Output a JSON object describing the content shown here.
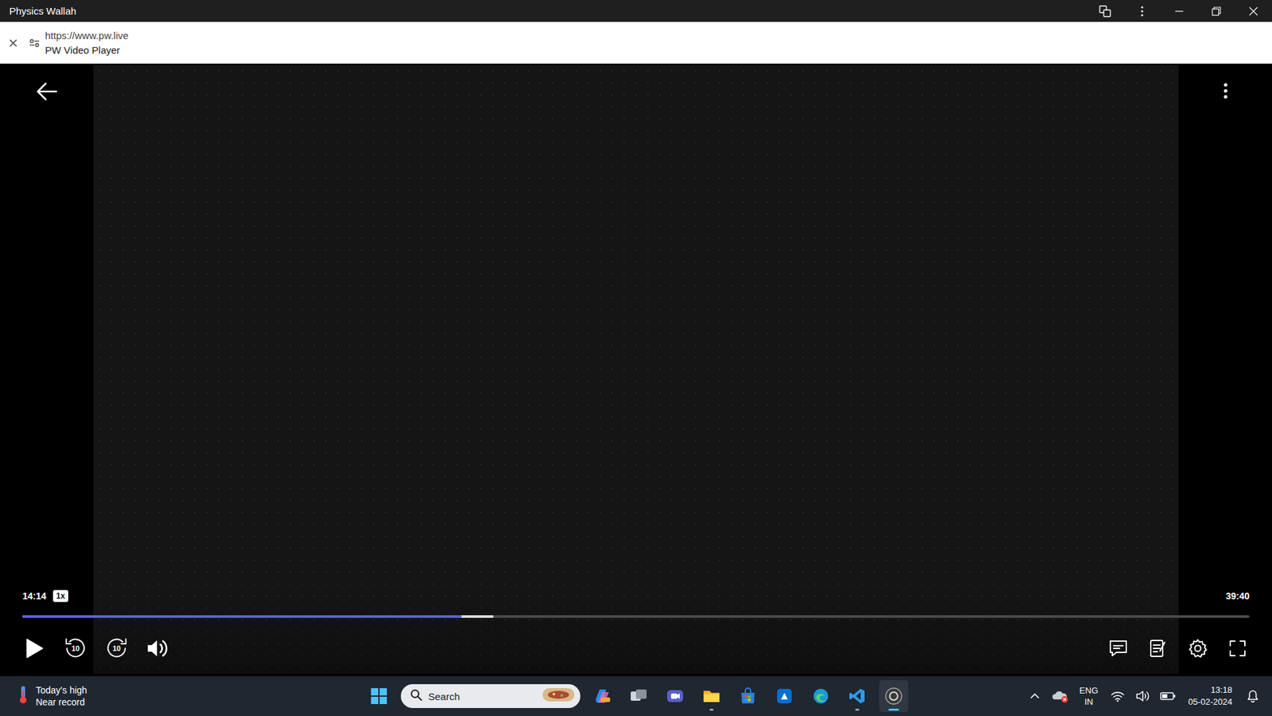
{
  "window": {
    "title": "Physics Wallah"
  },
  "address": {
    "url": "https://www.pw.live",
    "page_title": "PW Video Player"
  },
  "player": {
    "current_time": "14:14",
    "speed": "1x",
    "duration": "39:40",
    "playing": false,
    "progress": {
      "level": 0.358,
      "buffered": 0.384
    },
    "rewind": "10",
    "forward": "10"
  },
  "taskbar": {
    "weather": {
      "title": "Today's high",
      "subtitle": "Near record"
    },
    "search": {
      "placeholder": "Search"
    },
    "apps": [
      {
        "running": false,
        "active": false
      },
      {
        "running": false,
        "active": false
      },
      {
        "running": false,
        "active": false
      },
      {
        "running": true,
        "active": false
      },
      {
        "running": false,
        "active": false
      },
      {
        "running": false,
        "active": false
      },
      {
        "running": false,
        "active": false
      },
      {
        "running": true,
        "active": false
      },
      {
        "running": true,
        "active": true
      }
    ],
    "language": {
      "line1": "ENG",
      "line2": "IN"
    },
    "clock": {
      "time": "13:18",
      "date": "05-02-2024"
    }
  }
}
